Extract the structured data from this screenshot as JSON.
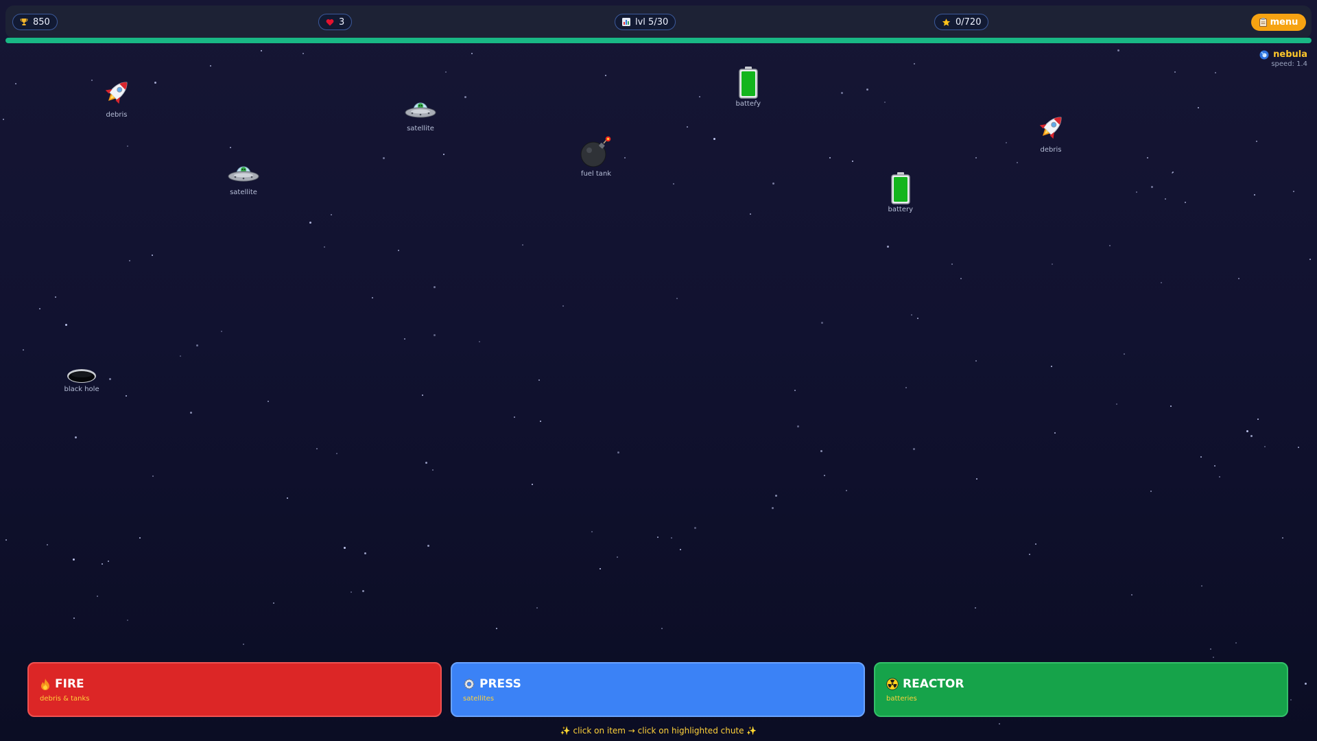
{
  "hud": {
    "score": "850",
    "lives": "3",
    "level": "lvl 5/30",
    "stars": "0/720",
    "menu_label": "menu",
    "level_progress": 1.0
  },
  "level_info": {
    "name": "nebula",
    "speed": "speed: 1.4"
  },
  "items": {
    "debris_1": "debris",
    "satellite_1": "satellite",
    "battery_1": "battery",
    "debris_2": "debris",
    "satellite_2": "satellite",
    "fuel_tank": "fuel tank",
    "battery_2": "battery",
    "black_hole": "black hole"
  },
  "chutes": {
    "fire": {
      "title": "FIRE",
      "subtitle": "debris & tanks",
      "color": "#dc2626"
    },
    "press": {
      "title": "PRESS",
      "subtitle": "satellites",
      "color": "#3b82f6"
    },
    "reactor": {
      "title": "REACTOR",
      "subtitle": "batteries",
      "color": "#16a34a"
    }
  },
  "hint": "✨  click on item → click on highlighted chute  ✨",
  "colors": {
    "background": "#111230",
    "accent": "#f6a312",
    "progress": "#19b885",
    "hint": "#ffd23a"
  }
}
